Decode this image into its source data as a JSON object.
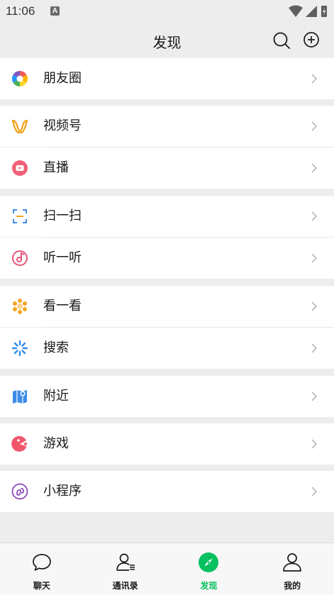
{
  "status_bar": {
    "time": "11:06",
    "badge": "A"
  },
  "header": {
    "title": "发现"
  },
  "groups": [
    {
      "items": [
        {
          "label": "朋友圈",
          "icon": "moments-icon"
        }
      ]
    },
    {
      "items": [
        {
          "label": "视频号",
          "icon": "channels-icon"
        },
        {
          "label": "直播",
          "icon": "live-icon"
        }
      ]
    },
    {
      "items": [
        {
          "label": "扫一扫",
          "icon": "scan-icon"
        },
        {
          "label": "听一听",
          "icon": "listen-icon"
        }
      ]
    },
    {
      "items": [
        {
          "label": "看一看",
          "icon": "top-stories-icon"
        },
        {
          "label": "搜索",
          "icon": "search-feature-icon"
        }
      ]
    },
    {
      "items": [
        {
          "label": "附近",
          "icon": "nearby-icon"
        }
      ]
    },
    {
      "items": [
        {
          "label": "游戏",
          "icon": "games-icon"
        }
      ]
    },
    {
      "items": [
        {
          "label": "小程序",
          "icon": "mini-programs-icon"
        }
      ]
    }
  ],
  "tabs": [
    {
      "label": "聊天",
      "icon": "chat-icon",
      "active": false
    },
    {
      "label": "通讯录",
      "icon": "contacts-icon",
      "active": false
    },
    {
      "label": "发现",
      "icon": "discover-icon",
      "active": true
    },
    {
      "label": "我的",
      "icon": "me-icon",
      "active": false
    }
  ],
  "colors": {
    "accent": "#07c160",
    "background": "#ededed",
    "surface": "#ffffff"
  }
}
